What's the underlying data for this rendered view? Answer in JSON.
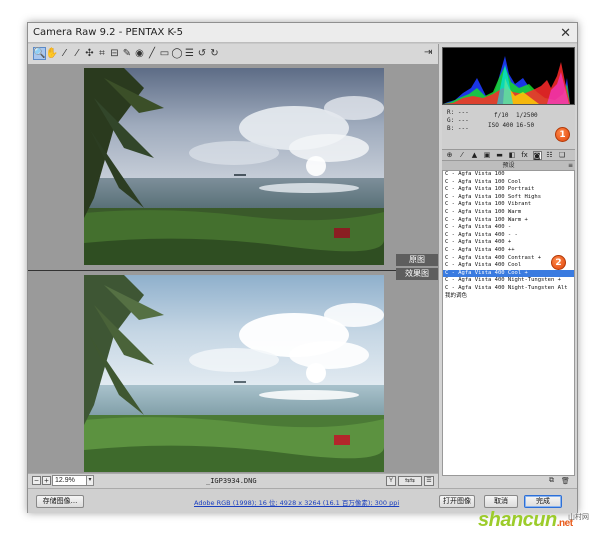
{
  "window": {
    "title": "Camera Raw 9.2 -  PENTAX K-5"
  },
  "toolbar": {
    "tools": [
      {
        "name": "zoom-tool",
        "glyph": "🔍",
        "icon": "zoom-icon",
        "active": true
      },
      {
        "name": "hand-tool",
        "glyph": "✋",
        "icon": "hand-icon"
      },
      {
        "name": "white-balance-tool",
        "glyph": "⁄",
        "icon": "eyedropper-icon"
      },
      {
        "name": "color-sampler-tool",
        "glyph": "⁄",
        "icon": "color-sampler-icon"
      },
      {
        "name": "targeted-adjustment-tool",
        "glyph": "✣",
        "icon": "target-adjust-icon"
      },
      {
        "name": "crop-tool",
        "glyph": "⌗",
        "icon": "crop-icon"
      },
      {
        "name": "straighten-tool",
        "glyph": "⊟",
        "icon": "straighten-icon"
      },
      {
        "name": "spot-removal-tool",
        "glyph": "✎",
        "icon": "spot-removal-icon"
      },
      {
        "name": "red-eye-tool",
        "glyph": "◉",
        "icon": "red-eye-icon"
      },
      {
        "name": "adjustment-brush-tool",
        "glyph": "╱",
        "icon": "brush-icon"
      },
      {
        "name": "graduated-filter-tool",
        "glyph": "▭",
        "icon": "graduated-filter-icon"
      },
      {
        "name": "radial-filter-tool",
        "glyph": "◯",
        "icon": "radial-filter-icon"
      },
      {
        "name": "preferences-tool",
        "glyph": "☰",
        "icon": "preferences-icon"
      },
      {
        "name": "rotate-ccw-tool",
        "glyph": "↺",
        "icon": "rotate-ccw-icon"
      },
      {
        "name": "rotate-cw-tool",
        "glyph": "↻",
        "icon": "rotate-cw-icon"
      }
    ],
    "export_glyph": "⇥"
  },
  "views": {
    "before_label": "原图",
    "after_label": "效果图"
  },
  "status": {
    "zoom_minus": "−",
    "zoom_plus": "+",
    "zoom_value": "12.9%",
    "zoom_arrow": "▾",
    "filename": "_IGP3934.DNG"
  },
  "info": {
    "r_label": "R:",
    "g_label": "G:",
    "b_label": "B:",
    "r_value": "---",
    "g_value": "---",
    "b_value": "---",
    "aperture": "f/10",
    "shutter": "1/2500",
    "iso": "ISO 400",
    "lens": "16-50"
  },
  "badges": {
    "one": "1",
    "two": "2"
  },
  "panel_tabs": [
    "⊕",
    "⁄",
    "▲",
    "▣",
    "▬",
    "◧",
    "fx",
    "◙",
    "☷",
    "❏"
  ],
  "presets": {
    "header": "预设",
    "menu_glyph": "≡",
    "items": [
      "C - Agfa Vista 100",
      "C - Agfa Vista 100 Cool",
      "C - Agfa Vista 100 Portrait",
      "C - Agfa Vista 100 Soft Highs",
      "C - Agfa Vista 100 Vibrant",
      "C - Agfa Vista 100 Warm",
      "C - Agfa Vista 100 Warm +",
      "C - Agfa Vista 400 -",
      "C - Agfa Vista 400 - -",
      "C - Agfa Vista 400 +",
      "C - Agfa Vista 400 ++",
      "C - Agfa Vista 400 Contrast +",
      "C - Agfa Vista 400 Cool",
      "C - Agfa Vista 400 Cool +",
      "C - Agfa Vista 400 Night-Tungsten +",
      "C - Agfa Vista 400 Night-Tungsten Alt",
      "我的调色"
    ],
    "selected_index": 13,
    "new_glyph": "⧉",
    "delete_glyph": "🗑"
  },
  "bottom": {
    "save_label": "存储图像...",
    "workflow_text": "Adobe RGB (1998); 16 位; 4928 x 3264 (16.1 百万像素); 300 ppi",
    "open_label": "打开图像",
    "cancel_label": "取消",
    "done_label": "完成"
  },
  "watermark": {
    "brand": "shancun",
    "tld": ".net",
    "cn": "山村网"
  },
  "colors": {
    "selection": "#3a7be0",
    "badge": "#e0440b",
    "window_bg": "#c9c9c9"
  }
}
